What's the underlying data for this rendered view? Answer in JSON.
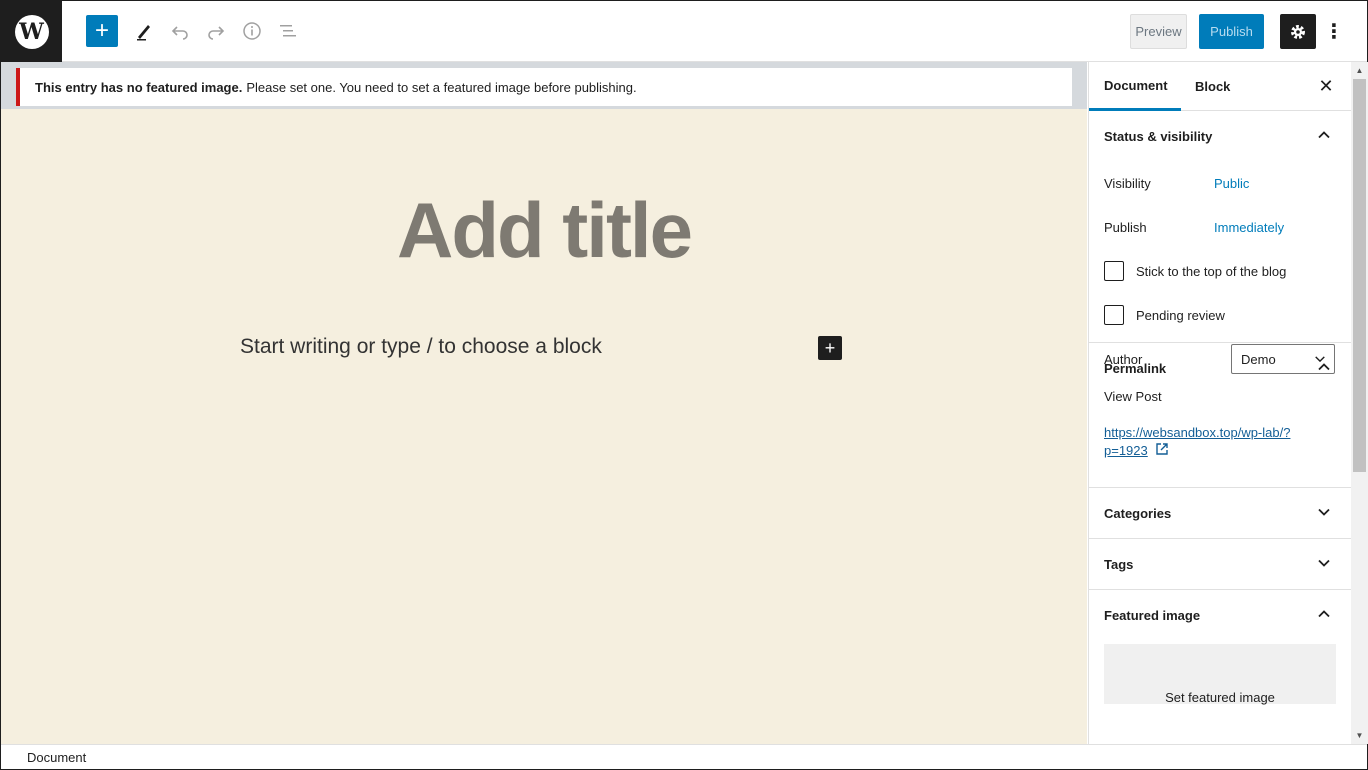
{
  "toolbar": {
    "logo_letter": "W",
    "add_icon": "+",
    "preview_label": "Preview",
    "publish_label": "Publish",
    "more_icon": "⋮"
  },
  "notice": {
    "bold": "This entry has no featured image.",
    "text": "Please set one. You need to set a featured image before publishing."
  },
  "editor": {
    "title_placeholder": "Add title",
    "body_placeholder": "Start writing or type / to choose a block",
    "add_block_icon": "+"
  },
  "sidebar": {
    "tabs": [
      "Document",
      "Block"
    ],
    "close_icon": "✕",
    "status": {
      "heading": "Status & visibility",
      "visibility_label": "Visibility",
      "visibility_value": "Public",
      "publish_label": "Publish",
      "publish_value": "Immediately",
      "sticky_label": "Stick to the top of the blog",
      "pending_label": "Pending review",
      "author_label": "Author",
      "author_value": "Demo"
    },
    "permalink": {
      "heading": "Permalink",
      "view_post": "View Post",
      "url_line1": "https://websandbox.top/wp-lab/?",
      "url_line2": "p=1923"
    },
    "categories_heading": "Categories",
    "tags_heading": "Tags",
    "featured": {
      "heading": "Featured image",
      "button": "Set featured image"
    }
  },
  "footer": {
    "breadcrumb": "Document"
  },
  "colors": {
    "accent": "#007cba",
    "editor_bg": "#f5efdf",
    "notice_border": "#cc1818"
  }
}
